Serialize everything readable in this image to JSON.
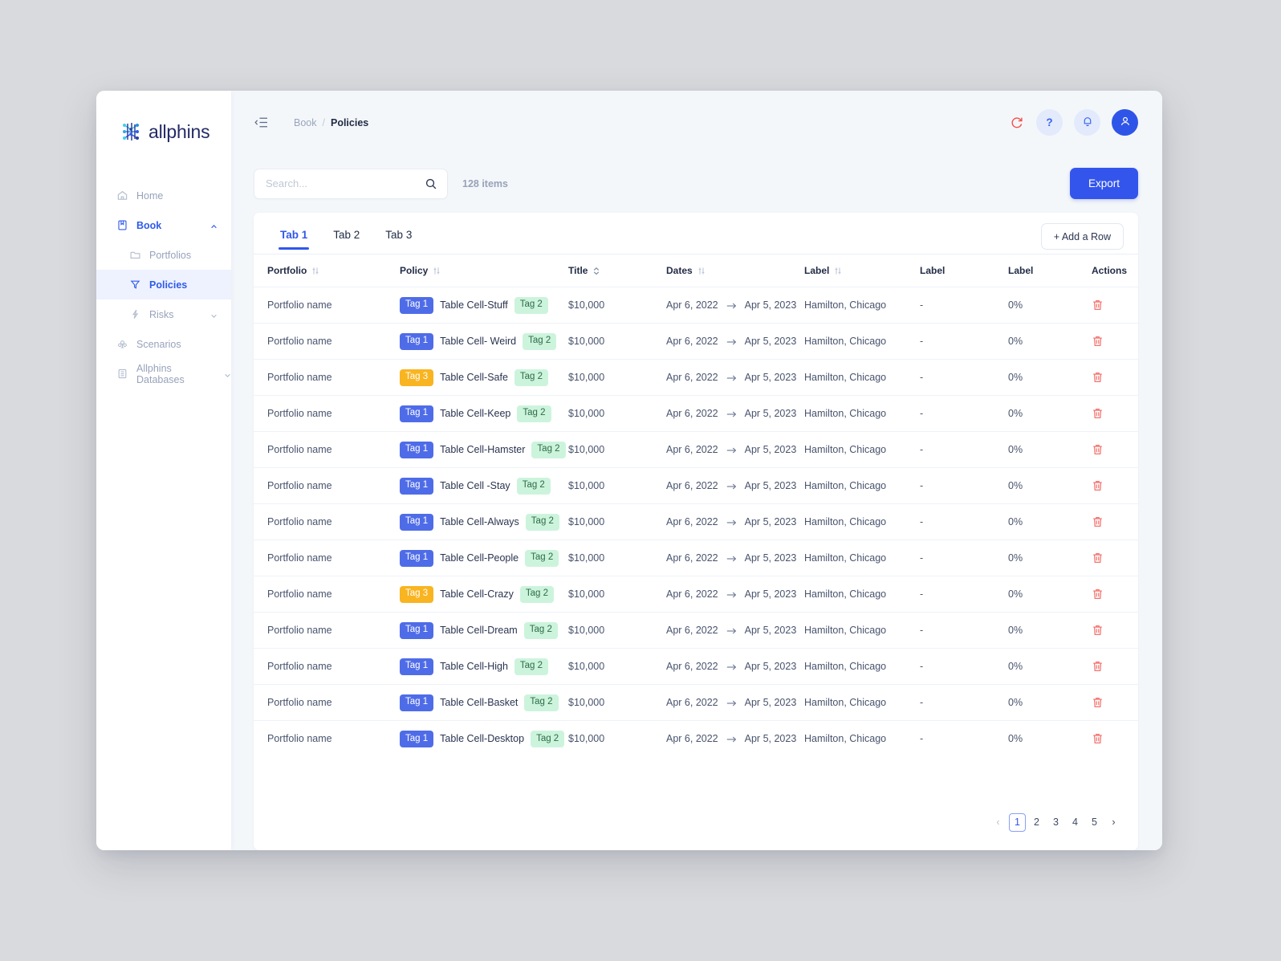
{
  "app": {
    "logo_text": "allphins"
  },
  "sidebar": {
    "items": [
      {
        "label": "Home",
        "icon": "home-icon",
        "level": "top",
        "active": false,
        "caret": ""
      },
      {
        "label": "Book",
        "icon": "book-icon",
        "level": "top",
        "active": true,
        "caret": "up"
      },
      {
        "label": "Portfolios",
        "icon": "folder-icon",
        "level": "sub",
        "active": false,
        "caret": ""
      },
      {
        "label": "Policies",
        "icon": "funnel-icon",
        "level": "sub",
        "active": true,
        "caret": ""
      },
      {
        "label": "Risks",
        "icon": "lightning-icon",
        "level": "sub",
        "active": false,
        "caret": "down"
      },
      {
        "label": "Scenarios",
        "icon": "scenarios-icon",
        "level": "top",
        "active": false,
        "caret": ""
      },
      {
        "label": "Allphins Databases",
        "icon": "database-icon",
        "level": "top",
        "active": false,
        "caret": "down-inline"
      }
    ]
  },
  "topbar": {
    "collapse_icon": "collapse-sidebar-icon",
    "breadcrumb": {
      "parent": "Book",
      "separator": "/",
      "current": "Policies"
    },
    "refresh_icon": "refresh-icon",
    "help_label": "?",
    "bell_icon": "bell-icon",
    "avatar_icon": "user-avatar-icon"
  },
  "search": {
    "value": "",
    "placeholder": "Search...",
    "icon": "search-icon",
    "items_count": "128 items"
  },
  "actions": {
    "export_label": "Export",
    "add_row_label": "+ Add a Row"
  },
  "tabs": [
    {
      "label": "Tab 1",
      "active": true
    },
    {
      "label": "Tab 2",
      "active": false
    },
    {
      "label": "Tab 3",
      "active": false
    }
  ],
  "table": {
    "columns": [
      {
        "label": "Portfolio",
        "sortable": true,
        "sort_icon": "sort-sliders-icon"
      },
      {
        "label": "Policy",
        "sortable": true,
        "sort_icon": "sort-sliders-icon"
      },
      {
        "label": "Title",
        "sortable": true,
        "sort_icon": "sort-chevrons-icon"
      },
      {
        "label": "Dates",
        "sortable": true,
        "sort_icon": "sort-sliders-icon"
      },
      {
        "label": "Label",
        "sortable": true,
        "sort_icon": "sort-sliders-icon"
      },
      {
        "label": "Label",
        "sortable": false,
        "sort_icon": ""
      },
      {
        "label": "Label",
        "sortable": false,
        "sort_icon": ""
      },
      {
        "label": "Actions",
        "sortable": false,
        "sort_icon": ""
      }
    ],
    "rows": [
      {
        "portfolio": "Portfolio name",
        "tag_left": "Tag 1",
        "tag_left_kind": "t1",
        "policy": "Table Cell-Stuff",
        "tag_right": "Tag 2",
        "title": "$10,000",
        "date_start": "Apr 6, 2022",
        "date_end": "Apr 5, 2023",
        "label1": "Hamilton, Chicago",
        "label2": "-",
        "label3": "0%",
        "action_icon": "trash-icon"
      },
      {
        "portfolio": "Portfolio name",
        "tag_left": "Tag 1",
        "tag_left_kind": "t1",
        "policy": "Table Cell- Weird",
        "tag_right": "Tag 2",
        "title": "$10,000",
        "date_start": "Apr 6, 2022",
        "date_end": "Apr 5, 2023",
        "label1": "Hamilton, Chicago",
        "label2": "-",
        "label3": "0%",
        "action_icon": "trash-icon"
      },
      {
        "portfolio": "Portfolio name",
        "tag_left": "Tag 3",
        "tag_left_kind": "t3",
        "policy": "Table Cell-Safe",
        "tag_right": "Tag 2",
        "title": "$10,000",
        "date_start": "Apr 6, 2022",
        "date_end": "Apr 5, 2023",
        "label1": "Hamilton, Chicago",
        "label2": "-",
        "label3": "0%",
        "action_icon": "trash-icon"
      },
      {
        "portfolio": "Portfolio name",
        "tag_left": "Tag 1",
        "tag_left_kind": "t1",
        "policy": "Table Cell-Keep",
        "tag_right": "Tag 2",
        "title": "$10,000",
        "date_start": "Apr 6, 2022",
        "date_end": "Apr 5, 2023",
        "label1": "Hamilton, Chicago",
        "label2": "-",
        "label3": "0%",
        "action_icon": "trash-icon"
      },
      {
        "portfolio": "Portfolio name",
        "tag_left": "Tag 1",
        "tag_left_kind": "t1",
        "policy": "Table Cell-Hamster",
        "tag_right": "Tag 2",
        "title": "$10,000",
        "date_start": "Apr 6, 2022",
        "date_end": "Apr 5, 2023",
        "label1": "Hamilton, Chicago",
        "label2": "-",
        "label3": "0%",
        "action_icon": "trash-icon"
      },
      {
        "portfolio": "Portfolio name",
        "tag_left": "Tag 1",
        "tag_left_kind": "t1",
        "policy": "Table Cell -Stay",
        "tag_right": "Tag 2",
        "title": "$10,000",
        "date_start": "Apr 6, 2022",
        "date_end": "Apr 5, 2023",
        "label1": "Hamilton, Chicago",
        "label2": "-",
        "label3": "0%",
        "action_icon": "trash-icon"
      },
      {
        "portfolio": "Portfolio name",
        "tag_left": "Tag 1",
        "tag_left_kind": "t1",
        "policy": "Table Cell-Always",
        "tag_right": "Tag 2",
        "title": "$10,000",
        "date_start": "Apr 6, 2022",
        "date_end": "Apr 5, 2023",
        "label1": "Hamilton, Chicago",
        "label2": "-",
        "label3": "0%",
        "action_icon": "trash-icon"
      },
      {
        "portfolio": "Portfolio name",
        "tag_left": "Tag 1",
        "tag_left_kind": "t1",
        "policy": "Table Cell-People",
        "tag_right": "Tag 2",
        "title": "$10,000",
        "date_start": "Apr 6, 2022",
        "date_end": "Apr 5, 2023",
        "label1": "Hamilton, Chicago",
        "label2": "-",
        "label3": "0%",
        "action_icon": "trash-icon"
      },
      {
        "portfolio": "Portfolio name",
        "tag_left": "Tag 3",
        "tag_left_kind": "t3",
        "policy": "Table Cell-Crazy",
        "tag_right": "Tag 2",
        "title": "$10,000",
        "date_start": "Apr 6, 2022",
        "date_end": "Apr 5, 2023",
        "label1": "Hamilton, Chicago",
        "label2": "-",
        "label3": "0%",
        "action_icon": "trash-icon"
      },
      {
        "portfolio": "Portfolio name",
        "tag_left": "Tag 1",
        "tag_left_kind": "t1",
        "policy": "Table Cell-Dream",
        "tag_right": "Tag 2",
        "title": "$10,000",
        "date_start": "Apr 6, 2022",
        "date_end": "Apr 5, 2023",
        "label1": "Hamilton, Chicago",
        "label2": "-",
        "label3": "0%",
        "action_icon": "trash-icon"
      },
      {
        "portfolio": "Portfolio name",
        "tag_left": "Tag 1",
        "tag_left_kind": "t1",
        "policy": "Table Cell-High",
        "tag_right": "Tag 2",
        "title": "$10,000",
        "date_start": "Apr 6, 2022",
        "date_end": "Apr 5, 2023",
        "label1": "Hamilton, Chicago",
        "label2": "-",
        "label3": "0%",
        "action_icon": "trash-icon"
      },
      {
        "portfolio": "Portfolio name",
        "tag_left": "Tag 1",
        "tag_left_kind": "t1",
        "policy": "Table Cell-Basket",
        "tag_right": "Tag 2",
        "title": "$10,000",
        "date_start": "Apr 6, 2022",
        "date_end": "Apr 5, 2023",
        "label1": "Hamilton, Chicago",
        "label2": "-",
        "label3": "0%",
        "action_icon": "trash-icon"
      },
      {
        "portfolio": "Portfolio name",
        "tag_left": "Tag 1",
        "tag_left_kind": "t1",
        "policy": "Table Cell-Desktop",
        "tag_right": "Tag 2",
        "title": "$10,000",
        "date_start": "Apr 6, 2022",
        "date_end": "Apr 5, 2023",
        "label1": "Hamilton, Chicago",
        "label2": "-",
        "label3": "0%",
        "action_icon": "trash-icon"
      }
    ]
  },
  "pagination": {
    "prev_label": "‹",
    "next_label": "›",
    "pages": [
      "1",
      "2",
      "3",
      "4",
      "5"
    ],
    "current": "1"
  },
  "colors": {
    "accent": "#3455ec",
    "tag1": "#4f6ce8",
    "tag2_bg": "#ccf4dc",
    "tag3": "#f9b421",
    "danger": "#f4736f",
    "page_bg": "#f4f7fa"
  }
}
